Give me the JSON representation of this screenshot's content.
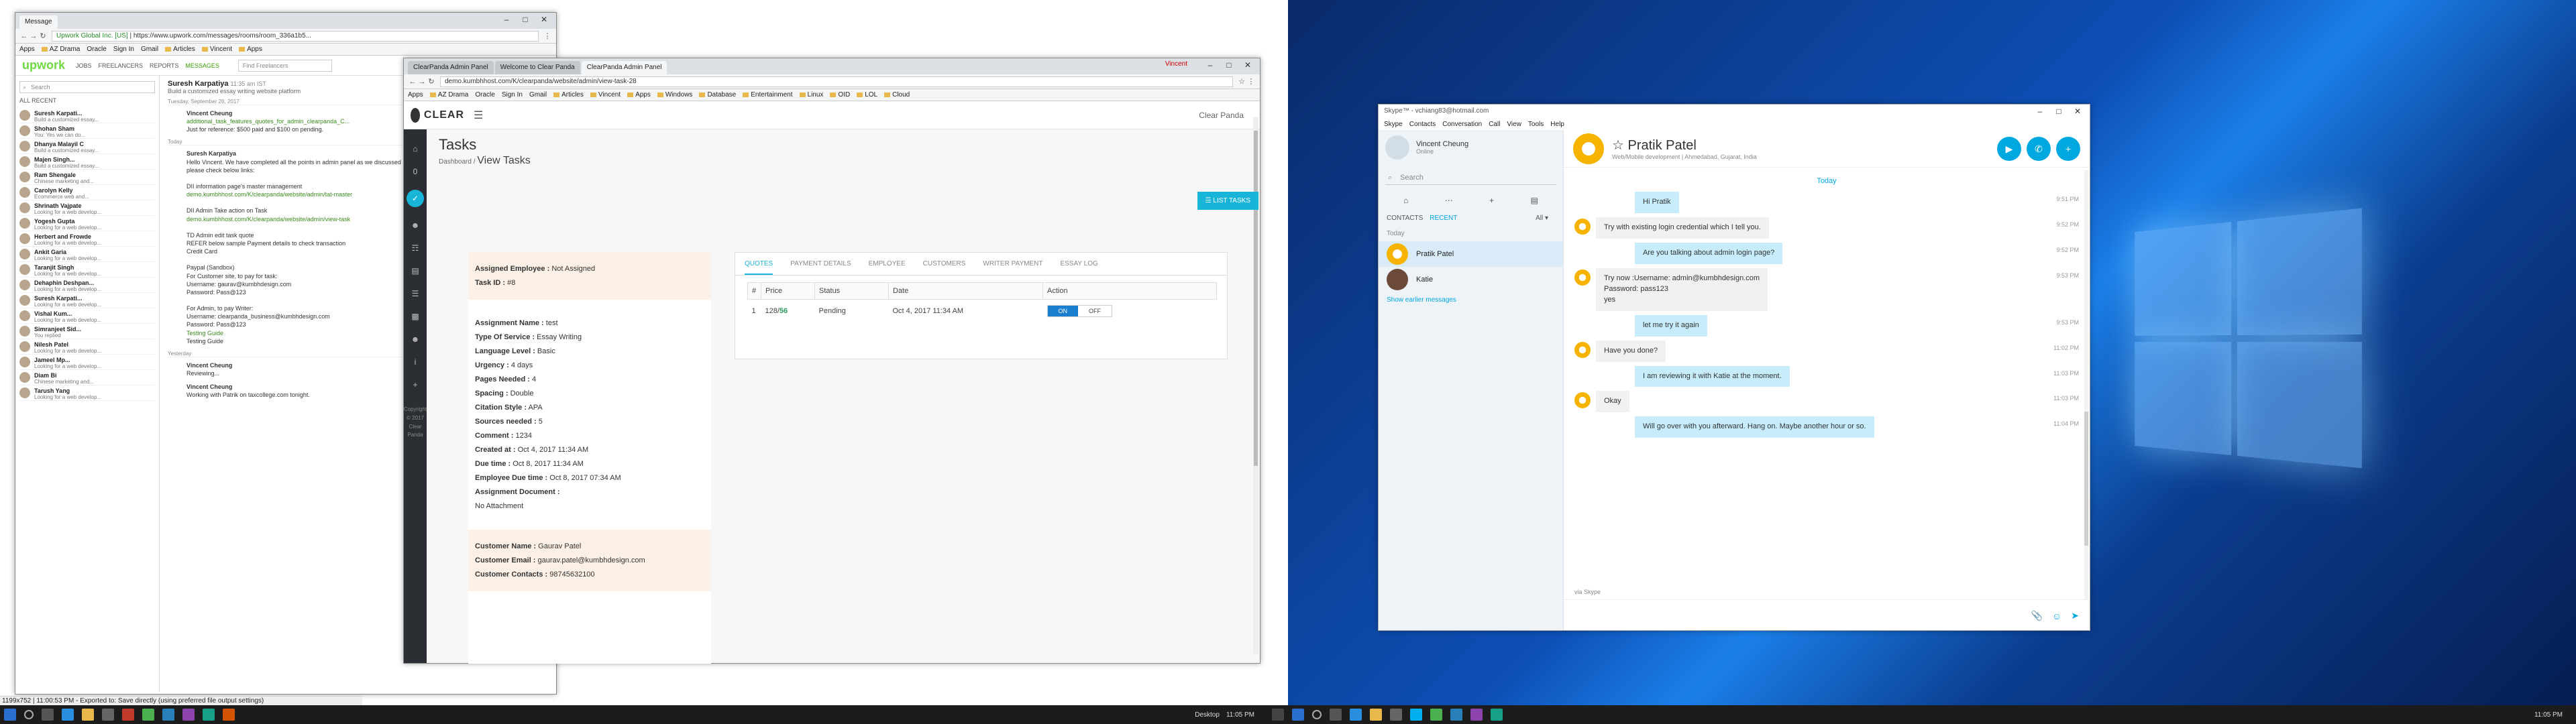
{
  "upwork": {
    "tab_title": "Message",
    "url": "https://www.upwork.com/messages/rooms/room_336a1b5...",
    "secure_label": "Upwork Global Inc. [US]",
    "bookmarks": [
      "Apps",
      "AZ Drama",
      "Oracle",
      "Sign In",
      "Gmail",
      "Articles",
      "Vincent",
      "Apps"
    ],
    "nav": [
      "JOBS",
      "FREELANCERS",
      "REPORTS",
      "MESSAGES"
    ],
    "find_placeholder": "Find Freelancers",
    "search_placeholder": "Search",
    "all_recent": "ALL RECENT",
    "contacts": [
      {
        "name": "Suresh Karpati...",
        "sub": "Build a customized essay..."
      },
      {
        "name": "Shohan Sham",
        "sub": "You: Yes we can do..."
      },
      {
        "name": "Dhanya Malayil C",
        "sub": "Build a customized essay..."
      },
      {
        "name": "Majen Singh...",
        "sub": "Build a customized essay..."
      },
      {
        "name": "Ram Shengale",
        "sub": "Chinese marketing and..."
      },
      {
        "name": "Carolyn Kelly",
        "sub": "Ecommerce web and..."
      },
      {
        "name": "Shrinath Vajpate",
        "sub": "Looking for a web develop..."
      },
      {
        "name": "Yogesh Gupta",
        "sub": "Looking for a web develop..."
      },
      {
        "name": "Herbert and Frowde",
        "sub": "Looking for a web develop..."
      },
      {
        "name": "Ankit Garia",
        "sub": "Looking for a web develop..."
      },
      {
        "name": "Taranjit Singh",
        "sub": "Looking for a web develop..."
      },
      {
        "name": "Dehaphin Deshpan...",
        "sub": "Looking for a web develop..."
      },
      {
        "name": "Suresh Karpati...",
        "sub": "Looking for a web develop..."
      },
      {
        "name": "Vishal Kum...",
        "sub": "Looking for a web develop..."
      },
      {
        "name": "Simranjeet Sid...",
        "sub": "You replied"
      },
      {
        "name": "Nilesh Patel",
        "sub": "Looking for a web develop..."
      },
      {
        "name": "Jameel Mp...",
        "sub": "Looking for a web develop..."
      },
      {
        "name": "Diam Bi",
        "sub": "Chinese marketing and..."
      },
      {
        "name": "Tarush Yang",
        "sub": "Looking for a web develop..."
      }
    ],
    "chat_name": "Suresh Karpatiya",
    "chat_time": "11:35 am IST",
    "chat_sub": "Build a customized essay writing website platform",
    "day1": "Tuesday, September 26, 2017",
    "msg1_name": "Vincent Cheung",
    "msg1_link": "additional_task_features_quotes_for_admin_clearpanda_C...",
    "msg1_text": "Just for reference: $500 paid and $100 on pending.",
    "day2": "Today",
    "msg2_name": "Suresh Karpatiya",
    "msg2_text": "Hello Vincent. We have completed all the points in admin panel as we discussed in the quote, revisions. But at last we discussed, please check below links:",
    "msg2_l1": "DII information page's master management",
    "msg2_l2": "demo.kumbhhost.com/K/clearpanda/website/admin/tat-master",
    "msg2_l3": "DII Admin Take action on Task",
    "msg2_l4": "demo.kumbhhost.com/K/clearpanda/website/admin/view-task",
    "msg2_l5": "TD Admin edit task quote",
    "msg2_l6": "REFER below sample Payment details to check transaction",
    "msg2_l7": "Credit Card",
    "msg2_l8": "Paypal (Sandbox)",
    "msg2_l9": "For Customer site, to pay for task:",
    "msg2_l10": "Username: gaurav@kumbhdesign.com",
    "msg2_l11": "Password: Pass@123",
    "msg2_l12": "For Admin, to pay Writer:",
    "msg2_l13": "Username: clearpanda_business@kumbhdesign.com",
    "msg2_l14": "Password: Pass@123",
    "msg2_l15": "Testing Guide",
    "msg2_l16": "Testing Guide",
    "day3": "Yesterday",
    "msg3_name": "Vincent Cheung",
    "msg3_text": "Reviewing...",
    "msg4_name": "Vincent Cheung",
    "msg4_text": "Working with Patrik on taxcollege.com tonight."
  },
  "clearpanda": {
    "tabs": [
      "ClearPanda Admin Panel",
      "Welcome to Clear Panda",
      "ClearPanda Admin Panel"
    ],
    "url": "demo.kumbhhost.com/K/clearpanda/website/admin/view-task-28",
    "user_tag": "Vincent",
    "bookmarks": [
      "Apps",
      "AZ Drama",
      "Oracle",
      "Sign In",
      "Gmail",
      "Articles",
      "Vincent",
      "Apps",
      "Windows",
      "Database",
      "Entertainment",
      "Linux",
      "OID",
      "LOL",
      "Cloud"
    ],
    "logo_text": "CLEAR",
    "logo_sub": "PANDA",
    "header_user": "Clear Panda",
    "page_title": "Tasks",
    "breadcrumb_root": "Dashboard",
    "breadcrumb_current": "View Tasks",
    "list_button": "LIST TASKS",
    "copyright": [
      "Copyright",
      "© 2017",
      "Clear",
      "Panda"
    ],
    "fields": [
      {
        "label": "Assigned Employee :",
        "value": "Not Assigned"
      },
      {
        "label": "Task ID :",
        "value": "#8"
      }
    ],
    "details": [
      {
        "label": "Assignment Name :",
        "value": "test"
      },
      {
        "label": "Type Of Service :",
        "value": "Essay Writing"
      },
      {
        "label": "Language Level :",
        "value": "Basic"
      },
      {
        "label": "Urgency :",
        "value": "4 days"
      },
      {
        "label": "Pages Needed :",
        "value": "4"
      },
      {
        "label": "Spacing :",
        "value": "Double"
      },
      {
        "label": "Citation Style :",
        "value": "APA"
      },
      {
        "label": "Sources needed :",
        "value": "5"
      },
      {
        "label": "Comment :",
        "value": "1234"
      },
      {
        "label": "Created at :",
        "value": "Oct 4, 2017 11:34 AM"
      },
      {
        "label": "Due time :",
        "value": "Oct 8, 2017 11:34 AM"
      },
      {
        "label": "Employee Due time :",
        "value": "Oct 8, 2017 07:34 AM"
      },
      {
        "label": "Assignment Document :",
        "value": ""
      },
      {
        "label": "",
        "value": "No Attachment"
      }
    ],
    "customer": [
      {
        "label": "Customer Name :",
        "value": "Gaurav Patel"
      },
      {
        "label": "Customer Email :",
        "value": "gaurav.patel@kumbhdesign.com"
      },
      {
        "label": "Customer Contacts :",
        "value": "98745632100"
      }
    ],
    "panel_tabs": [
      "QUOTES",
      "PAYMENT DETAILS",
      "EMPLOYEE",
      "CUSTOMERS",
      "WRITER PAYMENT",
      "ESSAY LOG"
    ],
    "table_headers": [
      "#",
      "Price",
      "Status",
      "Date",
      "Action"
    ],
    "row": {
      "num": "1",
      "price_a": "128/",
      "price_b": "56",
      "status": "Pending",
      "date": "Oct 4, 2017 11:34 AM",
      "on": "ON",
      "off": "OFF"
    }
  },
  "skype": {
    "title": "Skype™ - vchiang83@hotmail.com",
    "menu": [
      "Skype",
      "Contacts",
      "Conversation",
      "Call",
      "View",
      "Tools",
      "Help"
    ],
    "me_name": "Vincent Cheung",
    "me_status": "Online",
    "search": "Search",
    "tab_contacts": "CONTACTS",
    "tab_recent": "RECENT",
    "tab_all": "All ▾",
    "section_today": "Today",
    "items": [
      "Pratik Patel",
      "Katie"
    ],
    "show_earlier": "Show earlier messages",
    "chat_name": "Pratik Patel",
    "chat_sub": "Web/Mobile development | Ahmedabad, Gujarat, India",
    "today": "Today",
    "messages": [
      {
        "dir": "out",
        "text": "Hi Pratik",
        "time": "9:51 PM"
      },
      {
        "dir": "in",
        "text": "Try with existing login credential which I tell you.",
        "time": "9:52 PM"
      },
      {
        "dir": "out",
        "text": "Are you talking about admin login page?",
        "time": "9:52 PM"
      },
      {
        "dir": "in",
        "text": "Try now :Username: admin@kumbhdesign.com\n           Password: pass123\nyes",
        "time": "9:53 PM"
      },
      {
        "dir": "out",
        "text": "let me try it again",
        "time": "9:53 PM"
      },
      {
        "dir": "in",
        "text": "Have you done?",
        "time": "11:02 PM"
      },
      {
        "dir": "out",
        "text": "I am reviewing it with Katie at the moment.",
        "time": "11:03 PM"
      },
      {
        "dir": "in",
        "text": "Okay",
        "time": "11:03 PM"
      },
      {
        "dir": "out",
        "text": "Will go over with you afterward. Hang on.  Maybe another hour or so.",
        "time": "11:04 PM"
      }
    ],
    "via": "via Skype"
  },
  "taskbar": {
    "status_text": "1199x752 | 11:00:53 PM - Exported to: Save directly (using preferred file output settings)",
    "left_desktop": "Desktop",
    "left_time": "11:05 PM",
    "right_time": "11:05 PM"
  }
}
